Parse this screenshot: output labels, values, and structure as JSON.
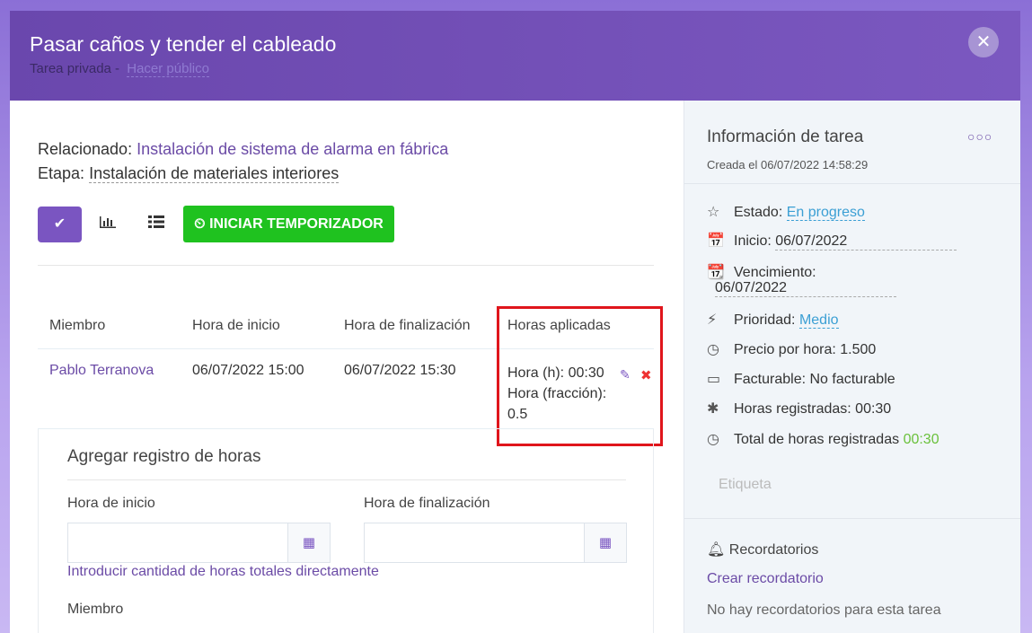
{
  "modal": {
    "title": "Pasar caños y tender el cableado",
    "subtitle_prefix": "Tarea privada -",
    "subtitle_link": "Hacer público",
    "close_symbol": "✕"
  },
  "task": {
    "related_label": "Relacionado:",
    "related_value": "Instalación de sistema de alarma en fábrica",
    "stage_label": "Etapa:",
    "stage_value": "Instalación de materiales interiores"
  },
  "toolbar": {
    "check_symbol": "✔",
    "chart_symbol": "📊",
    "list_symbol": "☰",
    "timer_label": "INICIAR TEMPORIZADOR",
    "timer_icon": "⏲"
  },
  "timesheet": {
    "headers": [
      "Miembro",
      "Hora de inicio",
      "Hora de finalización",
      "Horas aplicadas"
    ],
    "row": {
      "member": "Pablo Terranova",
      "start": "06/07/2022 15:00",
      "end": "06/07/2022 15:30",
      "hours_h": "Hora (h): 00:30",
      "hours_fraction": "Hora (fracción): 0.5"
    }
  },
  "add_entry": {
    "title": "Agregar registro de horas",
    "start_label": "Hora de inicio",
    "end_label": "Hora de finalización",
    "start_value": "",
    "end_value": "",
    "direct_link": "Introducir cantidad de horas totales directamente",
    "member_label": "Miembro"
  },
  "info": {
    "title": "Información de tarea",
    "more_symbol": "○○○",
    "created": "Creada el 06/07/2022 14:58:29",
    "status_label": "Estado:",
    "status_value": "En progreso",
    "start_label": "Inicio:",
    "start_value": "06/07/2022",
    "due_label": "Vencimiento:",
    "due_value": "06/07/2022",
    "priority_label": "Prioridad:",
    "priority_value": "Medio",
    "rate": "Precio por hora: 1.500",
    "billable": "Facturable: No facturable",
    "logged": "Horas registradas: 00:30",
    "total_label": "Total de horas registradas",
    "total_value": "00:30",
    "tag_placeholder": "Etiqueta"
  },
  "reminders": {
    "title": "Recordatorios",
    "create_link": "Crear recordatorio",
    "empty": "No hay recordatorios para esta tarea"
  },
  "colors": {
    "header": "#6a47ad",
    "accent": "#7a55c1",
    "timer": "#1fc21f",
    "highlight_box": "#e0151c",
    "link_blue": "#3b9fd4",
    "green_value": "#6ac13c"
  }
}
